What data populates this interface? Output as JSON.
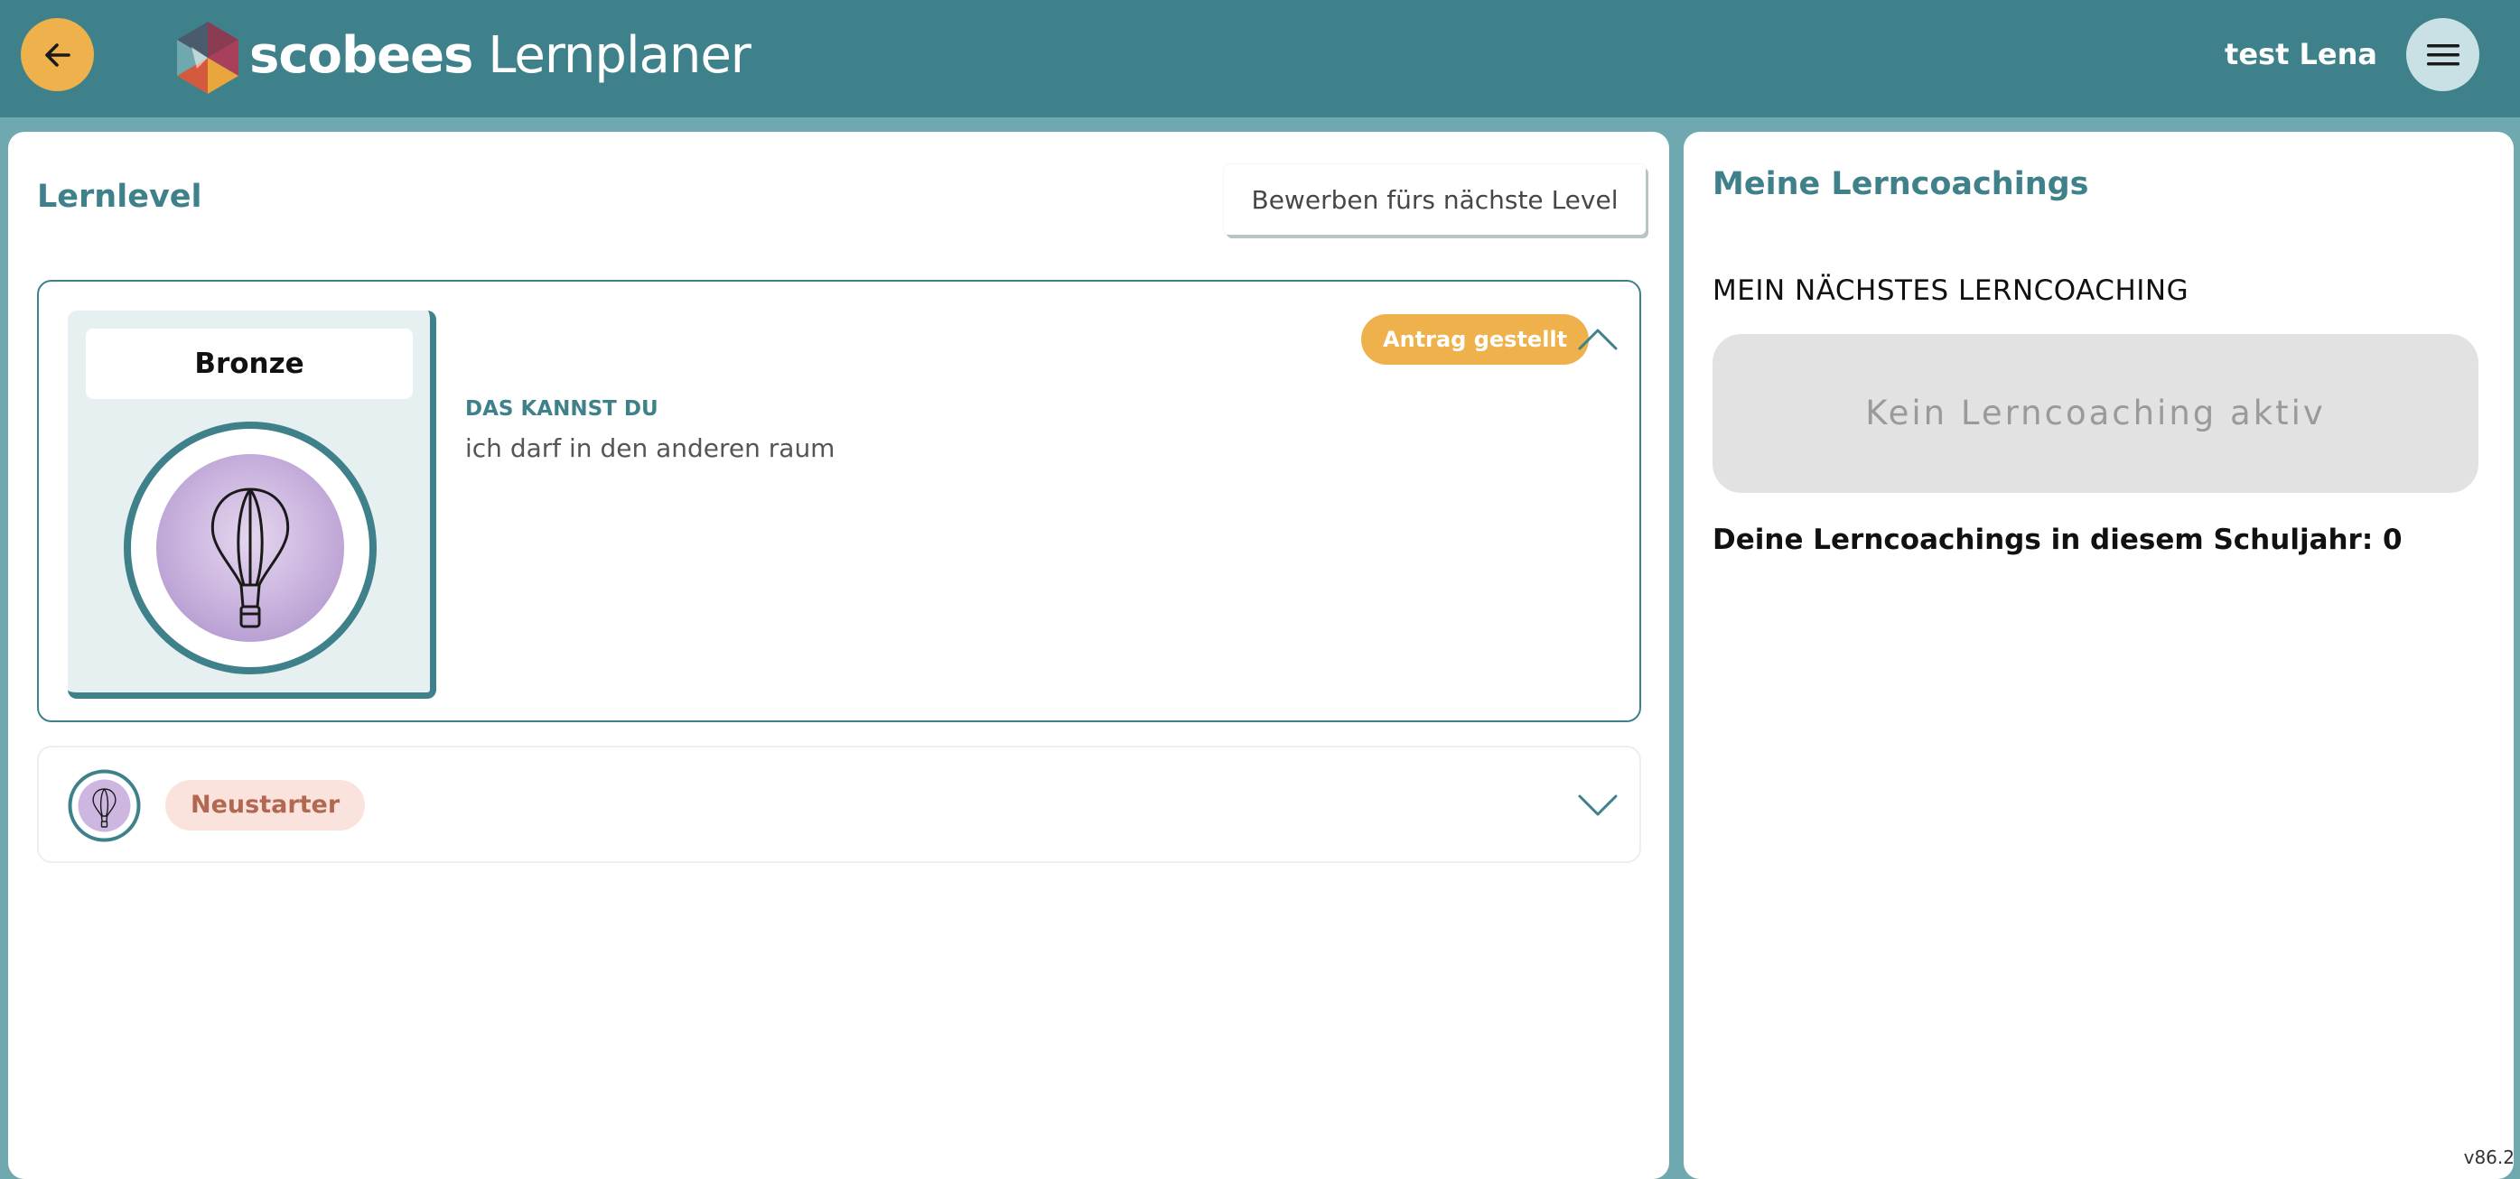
{
  "header": {
    "logo_brand": "scobees",
    "logo_product": "Lernplaner",
    "user_name": "test Lena"
  },
  "lernlevel": {
    "title": "Lernlevel",
    "apply_button": "Bewerben fürs nächste Level",
    "current_level": {
      "name": "Bronze",
      "status": "Antrag gestellt",
      "skills_heading": "DAS KANNST DU",
      "skills_text": "ich darf in den anderen raum",
      "icon": "hot-air-balloon-icon"
    },
    "previous_level": {
      "name": "Neustarter",
      "icon": "hot-air-balloon-icon"
    }
  },
  "coachings": {
    "title": "Meine Lerncoachings",
    "next_label": "MEIN NÄCHSTES LERNCOACHING",
    "empty_text": "Kein Lerncoaching aktiv",
    "count_text": "Deine Lerncoachings in diesem Schuljahr: 0"
  },
  "version": "v86.2",
  "colors": {
    "header_bg": "#3f818a",
    "page_bg": "#6fa8ae",
    "accent_orange": "#eeb14b",
    "teal_text": "#3f818a",
    "neustarter_bg": "#fae3dd",
    "neustarter_text": "#b26850"
  }
}
